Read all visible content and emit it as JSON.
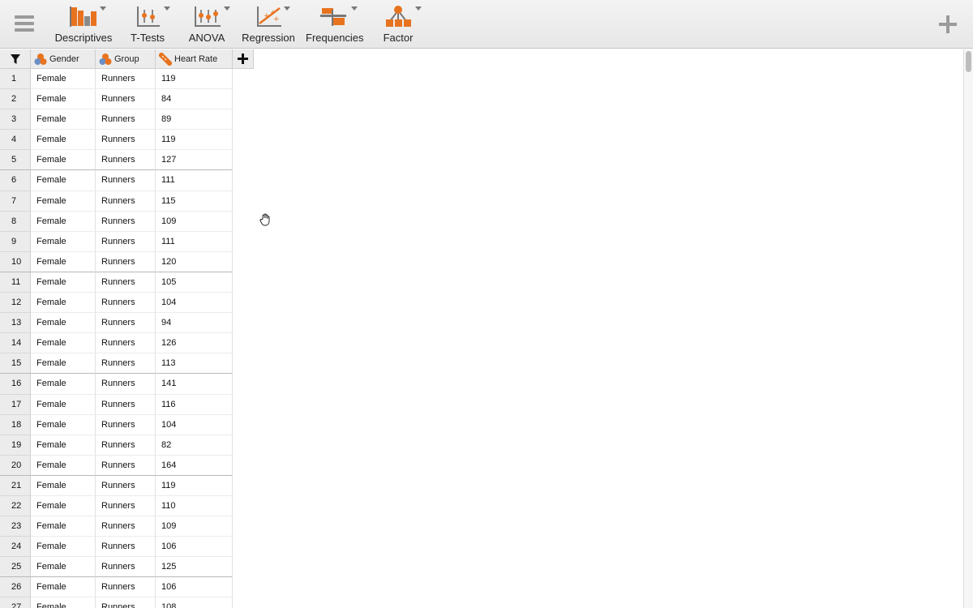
{
  "toolbar": {
    "tools": [
      {
        "label": "Descriptives",
        "icon": "descriptives-icon"
      },
      {
        "label": "T-Tests",
        "icon": "t-tests-icon"
      },
      {
        "label": "ANOVA",
        "icon": "anova-icon"
      },
      {
        "label": "Regression",
        "icon": "regression-icon"
      },
      {
        "label": "Frequencies",
        "icon": "frequencies-icon"
      },
      {
        "label": "Factor",
        "icon": "factor-icon"
      }
    ],
    "accent_color": "#e8731f"
  },
  "table": {
    "columns": [
      {
        "label": "Gender",
        "icon": "nominal-variable-icon"
      },
      {
        "label": "Group",
        "icon": "nominal-variable-icon"
      },
      {
        "label": "Heart Rate",
        "icon": "scale-variable-icon"
      }
    ],
    "rows": [
      {
        "n": "1",
        "gender": "Female",
        "group": "Runners",
        "hr": "119"
      },
      {
        "n": "2",
        "gender": "Female",
        "group": "Runners",
        "hr": "84"
      },
      {
        "n": "3",
        "gender": "Female",
        "group": "Runners",
        "hr": "89"
      },
      {
        "n": "4",
        "gender": "Female",
        "group": "Runners",
        "hr": "119"
      },
      {
        "n": "5",
        "gender": "Female",
        "group": "Runners",
        "hr": "127"
      },
      {
        "n": "6",
        "gender": "Female",
        "group": "Runners",
        "hr": "111"
      },
      {
        "n": "7",
        "gender": "Female",
        "group": "Runners",
        "hr": "115"
      },
      {
        "n": "8",
        "gender": "Female",
        "group": "Runners",
        "hr": "109"
      },
      {
        "n": "9",
        "gender": "Female",
        "group": "Runners",
        "hr": "111"
      },
      {
        "n": "10",
        "gender": "Female",
        "group": "Runners",
        "hr": "120"
      },
      {
        "n": "11",
        "gender": "Female",
        "group": "Runners",
        "hr": "105"
      },
      {
        "n": "12",
        "gender": "Female",
        "group": "Runners",
        "hr": "104"
      },
      {
        "n": "13",
        "gender": "Female",
        "group": "Runners",
        "hr": "94"
      },
      {
        "n": "14",
        "gender": "Female",
        "group": "Runners",
        "hr": "126"
      },
      {
        "n": "15",
        "gender": "Female",
        "group": "Runners",
        "hr": "113"
      },
      {
        "n": "16",
        "gender": "Female",
        "group": "Runners",
        "hr": "141"
      },
      {
        "n": "17",
        "gender": "Female",
        "group": "Runners",
        "hr": "116"
      },
      {
        "n": "18",
        "gender": "Female",
        "group": "Runners",
        "hr": "104"
      },
      {
        "n": "19",
        "gender": "Female",
        "group": "Runners",
        "hr": "82"
      },
      {
        "n": "20",
        "gender": "Female",
        "group": "Runners",
        "hr": "164"
      },
      {
        "n": "21",
        "gender": "Female",
        "group": "Runners",
        "hr": "119"
      },
      {
        "n": "22",
        "gender": "Female",
        "group": "Runners",
        "hr": "110"
      },
      {
        "n": "23",
        "gender": "Female",
        "group": "Runners",
        "hr": "109"
      },
      {
        "n": "24",
        "gender": "Female",
        "group": "Runners",
        "hr": "106"
      },
      {
        "n": "25",
        "gender": "Female",
        "group": "Runners",
        "hr": "125"
      },
      {
        "n": "26",
        "gender": "Female",
        "group": "Runners",
        "hr": "106"
      },
      {
        "n": "27",
        "gender": "Female",
        "group": "Runners",
        "hr": "108"
      }
    ]
  }
}
